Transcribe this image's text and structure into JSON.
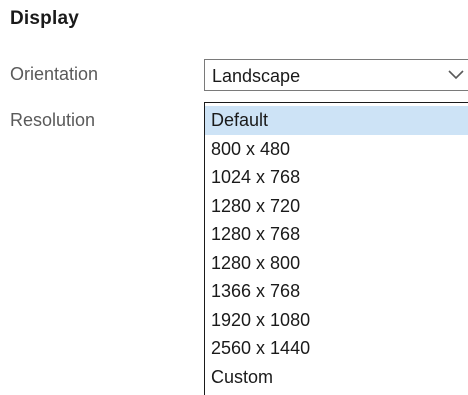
{
  "section": {
    "title": "Display"
  },
  "orientation": {
    "label": "Orientation",
    "value": "Landscape",
    "arrow_icon": "chevron-down-icon"
  },
  "resolution": {
    "label": "Resolution",
    "selected_index": 0,
    "options": [
      "Default",
      "800 x 480",
      "1024 x 768",
      "1280 x 720",
      "1280 x 768",
      "1280 x 800",
      "1366 x 768",
      "1920 x 1080",
      "2560 x 1440",
      "Custom"
    ]
  },
  "colors": {
    "selected_option_bg": "#cde3f6",
    "label_text": "#5a5a5a",
    "border": "#7a7a7a"
  }
}
